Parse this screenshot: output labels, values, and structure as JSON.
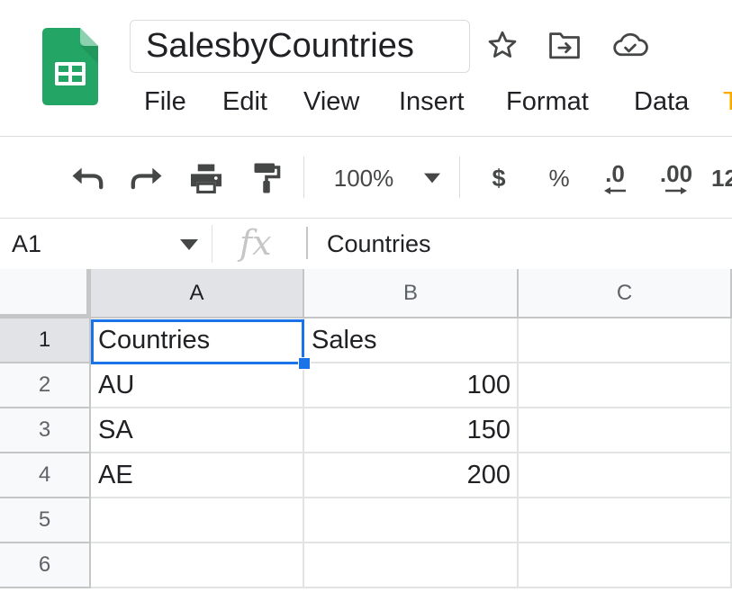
{
  "app": {
    "document_title": "SalesbyCountries",
    "menu": [
      "File",
      "Edit",
      "View",
      "Insert",
      "Format",
      "Data",
      "T"
    ]
  },
  "toolbar": {
    "zoom": "100%",
    "currency_symbol": "$",
    "percent_symbol": "%",
    "decrease_decimal": ".0",
    "increase_decimal": ".00",
    "more_formats": "12"
  },
  "formula_bar": {
    "cell_reference": "A1",
    "fx_label": "fx",
    "value": "Countries"
  },
  "grid": {
    "columns": [
      "A",
      "B",
      "C"
    ],
    "rows": [
      "1",
      "2",
      "3",
      "4",
      "5",
      "6"
    ],
    "cells": [
      [
        "Countries",
        "Sales",
        ""
      ],
      [
        "AU",
        "100",
        ""
      ],
      [
        "SA",
        "150",
        ""
      ],
      [
        "AE",
        "200",
        ""
      ],
      [
        "",
        "",
        ""
      ],
      [
        "",
        "",
        ""
      ]
    ],
    "selected_cell": "A1"
  },
  "colors": {
    "logo_green": "#0f9d58",
    "selection_blue": "#1a73e8",
    "header_bg": "#f8f9fa",
    "selected_header_bg": "#e1e3e6"
  }
}
